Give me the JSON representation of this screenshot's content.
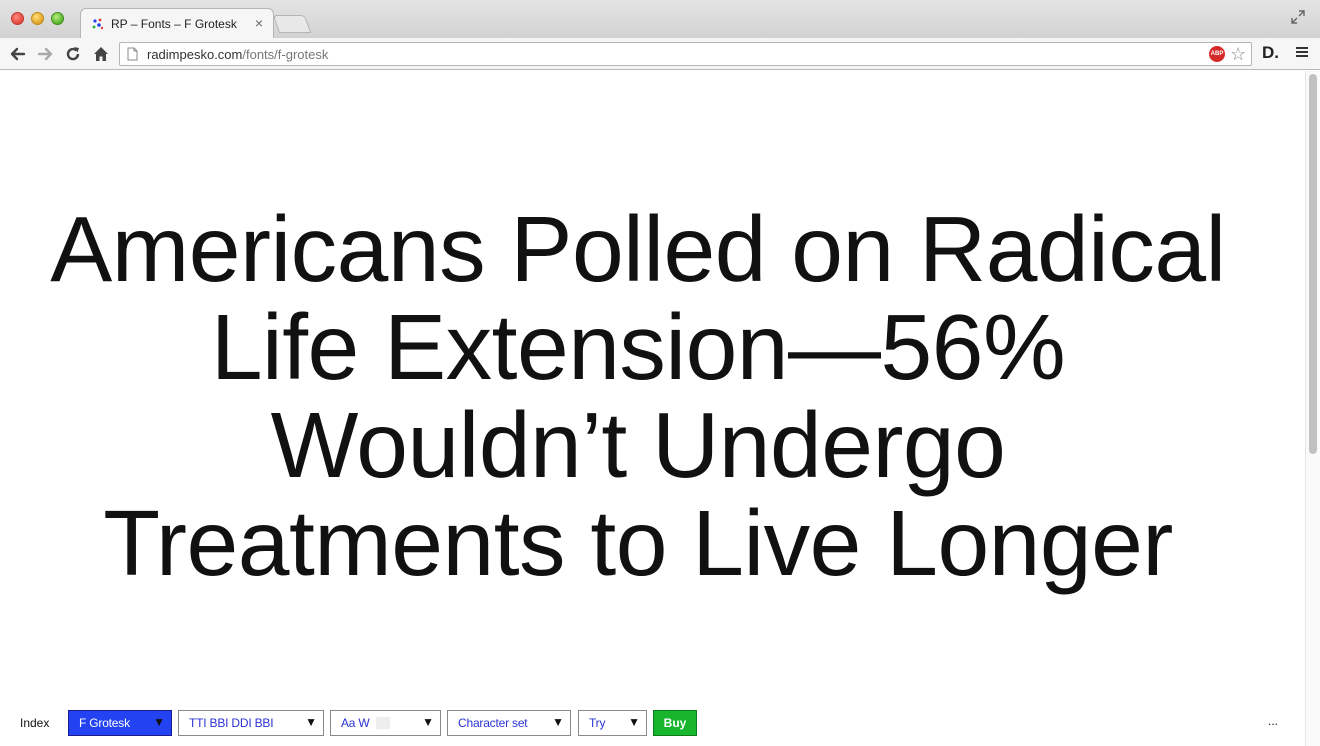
{
  "browser": {
    "tab": {
      "title": "RP – Fonts – F Grotesk"
    },
    "address": {
      "domain": "radimpesko.com",
      "path": "/fonts/f-grotesk"
    },
    "extensions": {
      "adblock_label": "ABP"
    }
  },
  "page": {
    "headline_lines": [
      "Americans Polled on Radical",
      "Life Extension—56%",
      "Wouldn’t Undergo",
      "Treatments to Live Longer"
    ]
  },
  "controls": {
    "index_label": "Index",
    "family_selected": "F Grotesk",
    "styles_label": "TTI  BBI  DDI  BBI",
    "sample_label": "Aa   W",
    "charset_label": "Character set",
    "try_label": "Try",
    "buy_label": "Buy",
    "more_label": "...",
    "dropdown_arrow": "▼"
  },
  "colors": {
    "family_bg": "#2342f2",
    "buy_bg": "#17b62c",
    "control_text": "#2a33d6",
    "headline_text": "#111111"
  },
  "icons": [
    "back-icon",
    "forward-icon",
    "reload-icon",
    "home-icon",
    "page-icon",
    "star-icon",
    "menu-icon",
    "fullscreen-icon",
    "close-icon"
  ]
}
